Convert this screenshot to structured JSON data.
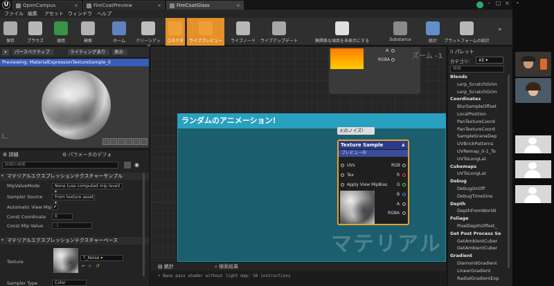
{
  "titlebar": {
    "tabs": [
      {
        "label": "OpenCampus"
      },
      {
        "label": "FireCoatPreview"
      },
      {
        "label": "FireCoatGlass"
      }
    ]
  },
  "menu": [
    "ファイル",
    "編集",
    "アセット",
    "ウィンドウ",
    "ヘルプ"
  ],
  "toolbar": [
    {
      "label": "保存",
      "color": "#bfbfbf"
    },
    {
      "label": "ブラウズ",
      "color": "#d0d0d0"
    },
    {
      "label": "適用",
      "color": "#3aa54a"
    },
    {
      "label": "検索",
      "color": "#c9c9c9"
    },
    {
      "label": "ホーム",
      "color": "#6a8fd8"
    },
    {
      "label": "クリーンアップ",
      "color": "#d8d8d8"
    },
    {
      "label": "コネクタ",
      "color": "#f0a33a"
    },
    {
      "label": "ライブプレビュー",
      "color": "#f0a33a"
    },
    {
      "label": "ライブノード",
      "color": "#cfcfcf"
    },
    {
      "label": "ライブアップデート",
      "color": "#bdbdbd"
    },
    {
      "label": "無関係な項目を非表示にする",
      "color": "#ffffff"
    },
    {
      "label": "Substance",
      "color": "#9a9a9a"
    },
    {
      "label": "統計",
      "color": "#6aa0e8"
    },
    {
      "label": "プラットフォームの統計",
      "color": "#cfcfcf"
    }
  ],
  "viewport": {
    "perspective_label": "パースペクティブ",
    "lighting_label": "ライティングあり",
    "show_label": "表示",
    "preview_banner": "Previewing: MaterialExpressionTextureSample_0"
  },
  "details": {
    "tab_details": "詳細",
    "tab_params": "パラメータのデフォ",
    "search_placeholder": "詳細の検索",
    "section1": "マテリアルエクスプレッションテクスチャーサンプル",
    "props": [
      {
        "label": "MipValueMode",
        "value": "None (use computed mip level)"
      },
      {
        "label": "Sampler Source",
        "value": "From texture asset"
      },
      {
        "label": "Automatic View Mip B",
        "value": "✔"
      },
      {
        "label": "Const Coordinate",
        "value": "0"
      },
      {
        "label": "Const Mip Value",
        "value": "-1"
      }
    ],
    "section2": "マテリアルエクスプレッションテクスチャーベース",
    "texture_label": "Texture",
    "texture_value": "T_Noise",
    "sampler_type_label": "Sampler Type",
    "sampler_type_value": "Color"
  },
  "graph": {
    "zoom": "ズーム -1",
    "top_pins": [
      "A",
      "RGBA"
    ],
    "comment_title": "ランダムのアニメーション!",
    "comment_bubble": "火のノイズ!",
    "watermark": "マテリアル",
    "node": {
      "title": "Texture Sample",
      "subtitle": "プレビュー中",
      "inputs": [
        "UVs",
        "Tex",
        "Apply View MipBias"
      ],
      "outputs": [
        "RGB",
        "R",
        "G",
        "B",
        "A",
        "RGBA"
      ]
    }
  },
  "bottom": {
    "tab_stats": "統計",
    "tab_search": "検索結果",
    "log": "• Base pass shader without light map: 50 instructions"
  },
  "palette": {
    "title": "パレット",
    "category_label": "カテゴリ:",
    "category_value": "All",
    "search_placeholder": "検索",
    "entries": [
      {
        "cat": "Blends"
      },
      {
        "item": "Lerp_ScratchGrim"
      },
      {
        "item": "Lerp_ScratchGrim"
      },
      {
        "cat": "Coordinates"
      },
      {
        "item": "BlurSampleOffset"
      },
      {
        "item": "LocalPosition"
      },
      {
        "item": "PanTextureCoord"
      },
      {
        "item": "PanTextureCoord"
      },
      {
        "item": "SampleSceneDep"
      },
      {
        "item": "UVBrickPatterns"
      },
      {
        "item": "UVRemap_0-1_To"
      },
      {
        "item": "UVToLongLat"
      },
      {
        "cat": "Cubemaps"
      },
      {
        "item": "UVToLongLat"
      },
      {
        "cat": "Debug"
      },
      {
        "item": "DebugOnOff"
      },
      {
        "item": "DebugTimeSine"
      },
      {
        "cat": "Depth"
      },
      {
        "item": "DepthFromWorldI"
      },
      {
        "cat": "Foliage"
      },
      {
        "item": "PixelDepthOffset_"
      },
      {
        "cat": "Get Post Process Se"
      },
      {
        "item": "GetAmbientCuber"
      },
      {
        "item": "GetAmbientCuber"
      },
      {
        "cat": "Gradient"
      },
      {
        "item": "DiamondGradient"
      },
      {
        "item": "LinearGradient"
      },
      {
        "item": "RadialGradientExp"
      }
    ]
  }
}
